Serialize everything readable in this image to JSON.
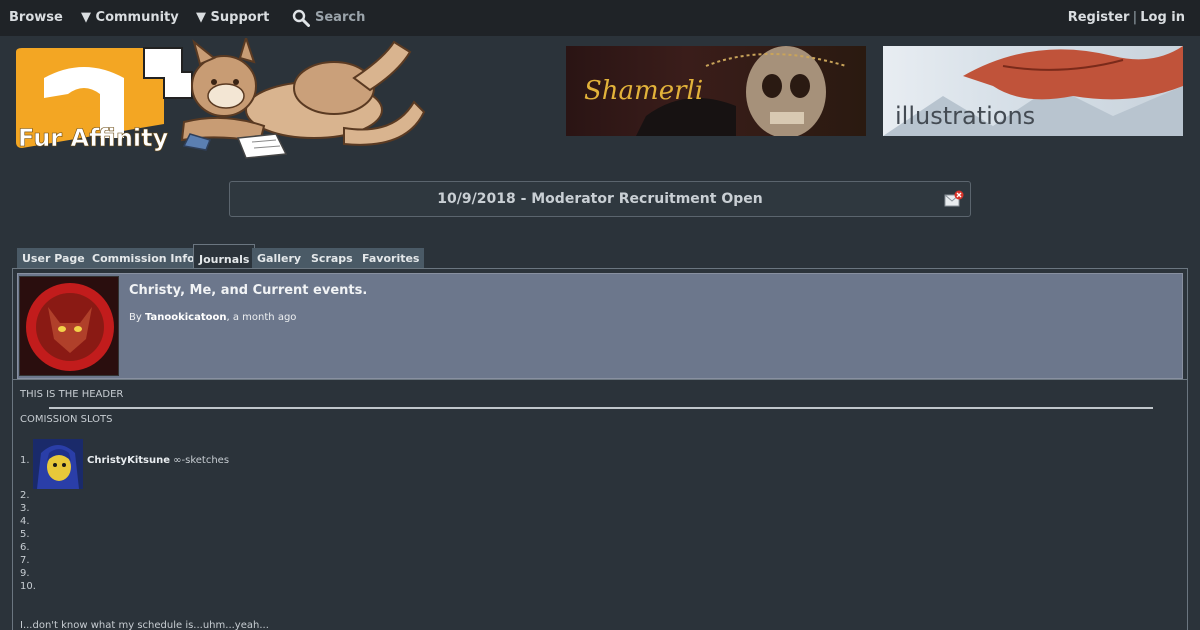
{
  "nav": {
    "browse": "Browse",
    "community": "▼ Community",
    "support": "▼ Support",
    "search": "Search",
    "register": "Register",
    "separator": "|",
    "login": "Log in"
  },
  "logo": {
    "text": "Fur Affinity"
  },
  "ads": [
    {
      "text": "Shamerli"
    },
    {
      "text": "illustrations"
    }
  ],
  "notice": {
    "text": "10/9/2018 - Moderator Recruitment Open"
  },
  "tabs": [
    {
      "label": "User Page"
    },
    {
      "label": "Commission Info"
    },
    {
      "label": "Journals"
    },
    {
      "label": "Gallery"
    },
    {
      "label": "Scraps"
    },
    {
      "label": "Favorites"
    }
  ],
  "journal": {
    "title": "Christy, Me, and Current events.",
    "by_prefix": "By",
    "author": "Tanookicatoon",
    "time": ", a month ago"
  },
  "body": {
    "header": "THIS IS THE HEADER",
    "slots_title": "COMISSION SLOTS",
    "slot1_num": "1.",
    "slot1_user": "ChristyKitsune",
    "slot1_note": " ∞-sketches",
    "numbers": [
      "2.",
      "3.",
      "4.",
      "5.",
      "6.",
      "7.",
      "9.",
      "10."
    ],
    "last_line": "I...don't know what my schedule is...uhm...yeah..."
  },
  "colors": {
    "background": "#2b333a",
    "nav_bg": "#1f2327",
    "tab_bg": "#4a5a66",
    "journal_head_bg": "#6c778c",
    "logo_orange": "#f3a623"
  }
}
